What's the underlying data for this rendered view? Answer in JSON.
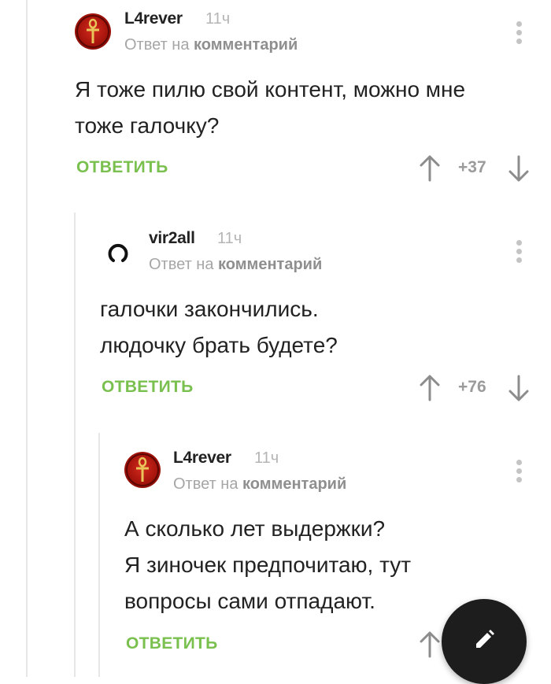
{
  "comments": [
    {
      "author": "L4rever",
      "time": "11ч",
      "reply_prefix": "Ответ на",
      "reply_target": "комментарий",
      "lines": [
        "Я тоже пилю свой контент, можно мне",
        "тоже галочку?"
      ],
      "reply_label": "ОТВЕТИТЬ",
      "score": "+37",
      "avatar": "ankh-avatar"
    },
    {
      "author": "vir2all",
      "time": "11ч",
      "reply_prefix": "Ответ на",
      "reply_target": "комментарий",
      "lines": [
        "галочки закончились.",
        "людочку брать будете?"
      ],
      "reply_label": "ОТВЕТИТЬ",
      "score": "+76",
      "avatar": "ring-avatar"
    },
    {
      "author": "L4rever",
      "time": "11ч",
      "reply_prefix": "Ответ на",
      "reply_target": "комментарий",
      "lines": [
        "А сколько лет выдержки?",
        "Я зиночек предпочитаю, тут",
        "вопросы сами отпадают."
      ],
      "reply_label": "ОТВЕТИТЬ",
      "avatar": "ankh-avatar"
    }
  ],
  "icons": {
    "menu": "vertical-dots-icon",
    "upvote": "arrow-up-icon",
    "downvote": "arrow-down-icon",
    "compose": "pencil-icon"
  },
  "colors": {
    "reply_green": "#7ac04f",
    "fab_bg": "#1d1d1d",
    "avatar_red": "#b3180f"
  }
}
